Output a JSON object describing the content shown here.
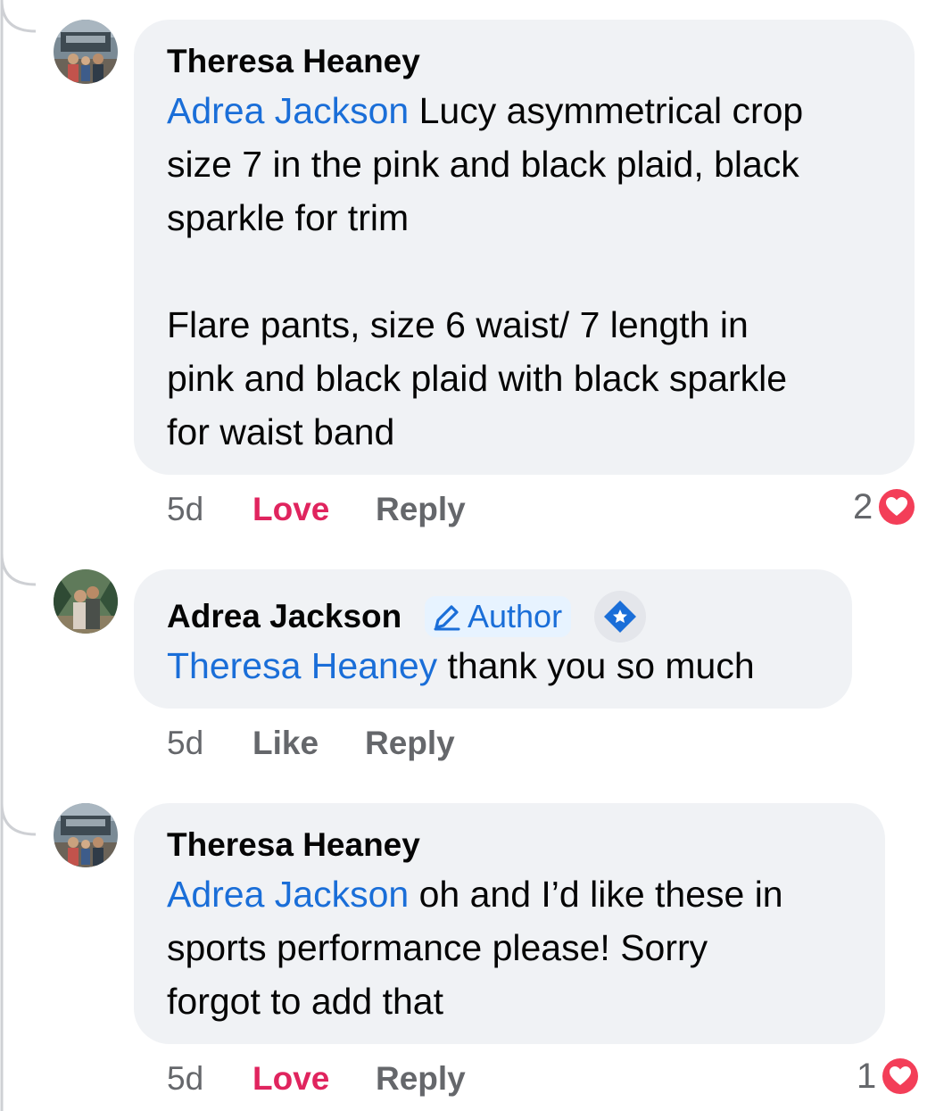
{
  "comments": [
    {
      "author": "Theresa Heaney",
      "mention": "Adrea Jackson",
      "text_line1": " Lucy asymmetrical crop",
      "text_line2": "size 7 in the pink and black plaid, black",
      "text_line3": "sparkle for trim",
      "text_line4": "Flare pants, size 6 waist/ 7 length in",
      "text_line5": "pink and black plaid with black sparkle",
      "text_line6": "for waist band",
      "time": "5d",
      "reaction_label": "Love",
      "reply_label": "Reply",
      "reaction_count": "2"
    },
    {
      "author": "Adrea Jackson",
      "author_badge": "Author",
      "mention": "Theresa Heaney",
      "text": " thank you so much",
      "time": "5d",
      "reaction_label": "Like",
      "reply_label": "Reply"
    },
    {
      "author": "Theresa Heaney",
      "mention": "Adrea Jackson",
      "text_line1": " oh and I’d like these in",
      "text_line2": "sports performance please! Sorry",
      "text_line3": "forgot to add that",
      "time": "5d",
      "reaction_label": "Love",
      "reply_label": "Reply",
      "reaction_count": "1"
    }
  ],
  "icons": {
    "heart": "heart-icon",
    "pencil": "pencil-icon",
    "verified": "verified-icon"
  },
  "colors": {
    "mention": "#1a6ed8",
    "love": "#e0245e",
    "bubble": "#f0f2f5",
    "meta": "#65676b"
  }
}
